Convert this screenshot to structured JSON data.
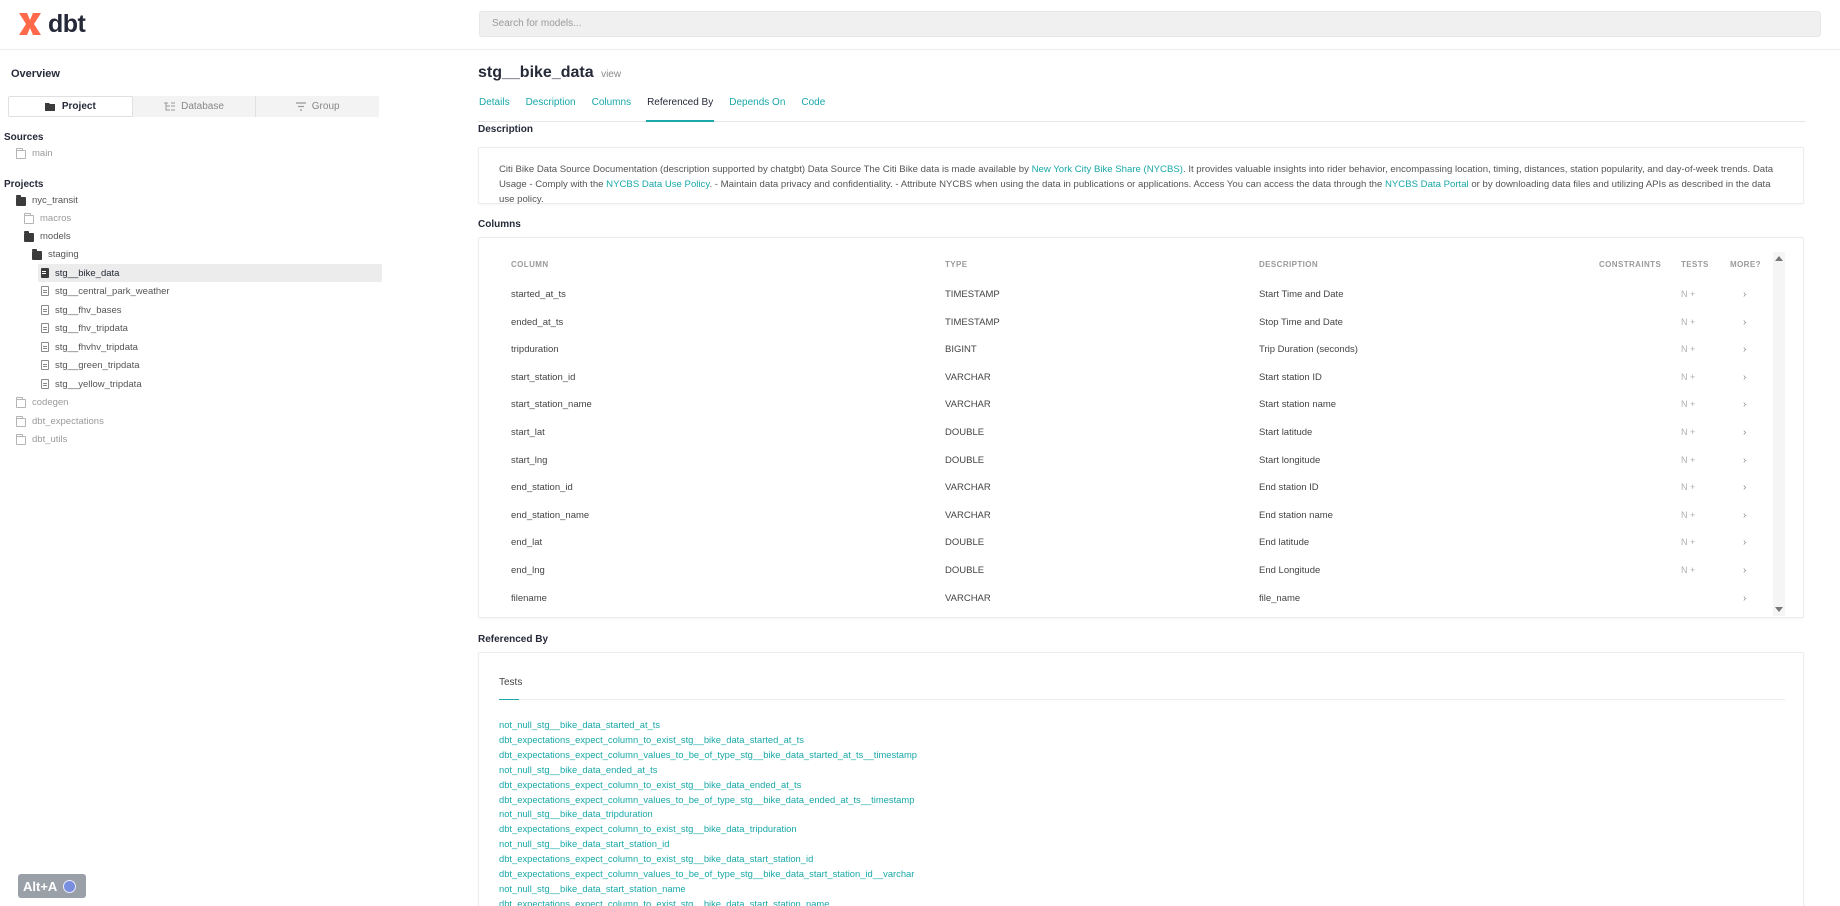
{
  "app": {
    "logo": "dbt",
    "brand_color": "#ff694b",
    "accent_color": "#1aa8a8"
  },
  "search": {
    "placeholder": "Search for models..."
  },
  "sidebar": {
    "overview": "Overview",
    "switcher": [
      {
        "label": "Project",
        "icon": "folder-open-icon",
        "active": true
      },
      {
        "label": "Database",
        "icon": "database-icon",
        "active": false
      },
      {
        "label": "Group",
        "icon": "group-icon",
        "active": false
      }
    ],
    "sources_label": "Sources",
    "sources": [
      {
        "label": "main"
      }
    ],
    "projects_label": "Projects",
    "tree": [
      {
        "label": "nyc_transit"
      },
      {
        "label": "macros"
      },
      {
        "label": "models"
      },
      {
        "label": "staging"
      },
      {
        "label": "stg__bike_data"
      },
      {
        "label": "stg__central_park_weather"
      },
      {
        "label": "stg__fhv_bases"
      },
      {
        "label": "stg__fhv_tripdata"
      },
      {
        "label": "stg__fhvhv_tripdata"
      },
      {
        "label": "stg__green_tripdata"
      },
      {
        "label": "stg__yellow_tripdata"
      },
      {
        "label": "codegen"
      },
      {
        "label": "dbt_expectations"
      },
      {
        "label": "dbt_utils"
      }
    ]
  },
  "model": {
    "name": "stg__bike_data",
    "kind": "view"
  },
  "tabs": [
    "Details",
    "Description",
    "Columns",
    "Referenced By",
    "Depends On",
    "Code"
  ],
  "description": {
    "heading": "Description",
    "parts": [
      "Citi Bike Data Source Documentation (description supported by chatgbt) Data Source The Citi Bike data is made available by ",
      "New York City Bike Share (NYCBS)",
      ". It provides valuable insights into rider behavior, encompassing location, timing, distances, station popularity, and day-of-week trends. Data Usage - Comply with the ",
      "NYCBS Data Use Policy",
      ". - Maintain data privacy and confidentiality. - Attribute NYCBS when using the data in publications or applications. Access You can access the data through the ",
      "NYCBS Data Portal",
      " or by downloading data files and utilizing APIs as described in the data use policy."
    ]
  },
  "columns": {
    "heading": "Columns",
    "headers": [
      "COLUMN",
      "TYPE",
      "DESCRIPTION",
      "CONSTRAINTS",
      "TESTS",
      "MORE?"
    ],
    "rows": [
      {
        "name": "started_at_ts",
        "type": "TIMESTAMP",
        "description": "Start Time and Date",
        "tests": "N +",
        "more": "›"
      },
      {
        "name": "ended_at_ts",
        "type": "TIMESTAMP",
        "description": "Stop Time and Date",
        "tests": "N +",
        "more": "›"
      },
      {
        "name": "tripduration",
        "type": "BIGINT",
        "description": "Trip Duration (seconds)",
        "tests": "N +",
        "more": "›"
      },
      {
        "name": "start_station_id",
        "type": "VARCHAR",
        "description": "Start station ID",
        "tests": "N +",
        "more": "›"
      },
      {
        "name": "start_station_name",
        "type": "VARCHAR",
        "description": "Start station name",
        "tests": "N +",
        "more": "›"
      },
      {
        "name": "start_lat",
        "type": "DOUBLE",
        "description": "Start latitude",
        "tests": "N +",
        "more": "›"
      },
      {
        "name": "start_lng",
        "type": "DOUBLE",
        "description": "Start longitude",
        "tests": "N +",
        "more": "›"
      },
      {
        "name": "end_station_id",
        "type": "VARCHAR",
        "description": "End station ID",
        "tests": "N +",
        "more": "›"
      },
      {
        "name": "end_station_name",
        "type": "VARCHAR",
        "description": "End station name",
        "tests": "N +",
        "more": "›"
      },
      {
        "name": "end_lat",
        "type": "DOUBLE",
        "description": "End latitude",
        "tests": "N +",
        "more": "›"
      },
      {
        "name": "end_lng",
        "type": "DOUBLE",
        "description": "End Longitude",
        "tests": "N +",
        "more": "›"
      },
      {
        "name": "filename",
        "type": "VARCHAR",
        "description": "file_name",
        "tests": "",
        "more": "›"
      }
    ]
  },
  "referenced_by": {
    "heading": "Referenced By",
    "tests_label": "Tests",
    "links": [
      "not_null_stg__bike_data_started_at_ts",
      "dbt_expectations_expect_column_to_exist_stg__bike_data_started_at_ts",
      "dbt_expectations_expect_column_values_to_be_of_type_stg__bike_data_started_at_ts__timestamp",
      "not_null_stg__bike_data_ended_at_ts",
      "dbt_expectations_expect_column_to_exist_stg__bike_data_ended_at_ts",
      "dbt_expectations_expect_column_values_to_be_of_type_stg__bike_data_ended_at_ts__timestamp",
      "not_null_stg__bike_data_tripduration",
      "dbt_expectations_expect_column_to_exist_stg__bike_data_tripduration",
      "not_null_stg__bike_data_start_station_id",
      "dbt_expectations_expect_column_to_exist_stg__bike_data_start_station_id",
      "dbt_expectations_expect_column_values_to_be_of_type_stg__bike_data_start_station_id__varchar",
      "not_null_stg__bike_data_start_station_name",
      "dbt_expectations_expect_column_to_exist_stg__bike_data_start_station_name"
    ]
  },
  "overlay": {
    "label": "Alt+A"
  }
}
